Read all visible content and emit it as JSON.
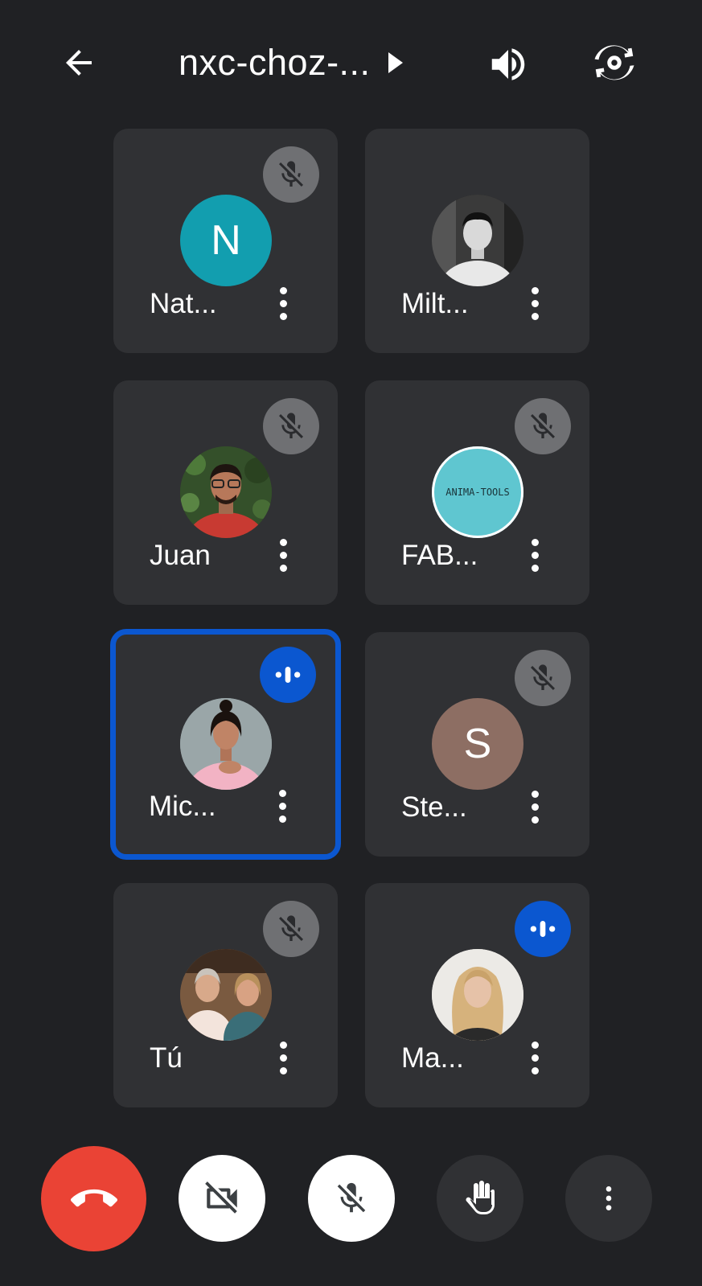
{
  "header": {
    "back_icon": "arrow-back-icon",
    "title": "nxc-choz-...",
    "title_caret_icon": "caret-right-icon",
    "speaker_icon": "volume-up-icon",
    "switch_camera_icon": "switch-camera-icon"
  },
  "participants": [
    {
      "name": "Nat...",
      "avatar": "initial",
      "initial": "N",
      "avatar_color": "#129eaf",
      "status": "muted"
    },
    {
      "name": "Milt...",
      "avatar": "photo",
      "status": "none"
    },
    {
      "name": "Juan",
      "avatar": "photo",
      "status": "muted"
    },
    {
      "name": "FAB...",
      "avatar": "logo",
      "logo_text": "ANIMA-TOOLS",
      "avatar_color": "#5fc6d0",
      "status": "muted"
    },
    {
      "name": "Mic...",
      "avatar": "photo",
      "status": "speaking",
      "active": true
    },
    {
      "name": "Ste...",
      "avatar": "initial",
      "initial": "S",
      "avatar_color": "#8d6e63",
      "status": "muted"
    },
    {
      "name": "Tú",
      "avatar": "photo",
      "status": "muted"
    },
    {
      "name": "Ma...",
      "avatar": "photo",
      "status": "speaking"
    }
  ],
  "controls": {
    "end_call_icon": "call-end-icon",
    "camera_icon": "videocam-off-icon",
    "mic_icon": "mic-off-icon",
    "raise_hand_icon": "raise-hand-icon",
    "more_icon": "more-vert-icon"
  },
  "colors": {
    "background": "#202124",
    "tile": "#303134",
    "active_border": "#0b57d0",
    "speaking": "#0b57d0",
    "muted_badge": "#6f7073",
    "end_call": "#ea4335"
  }
}
